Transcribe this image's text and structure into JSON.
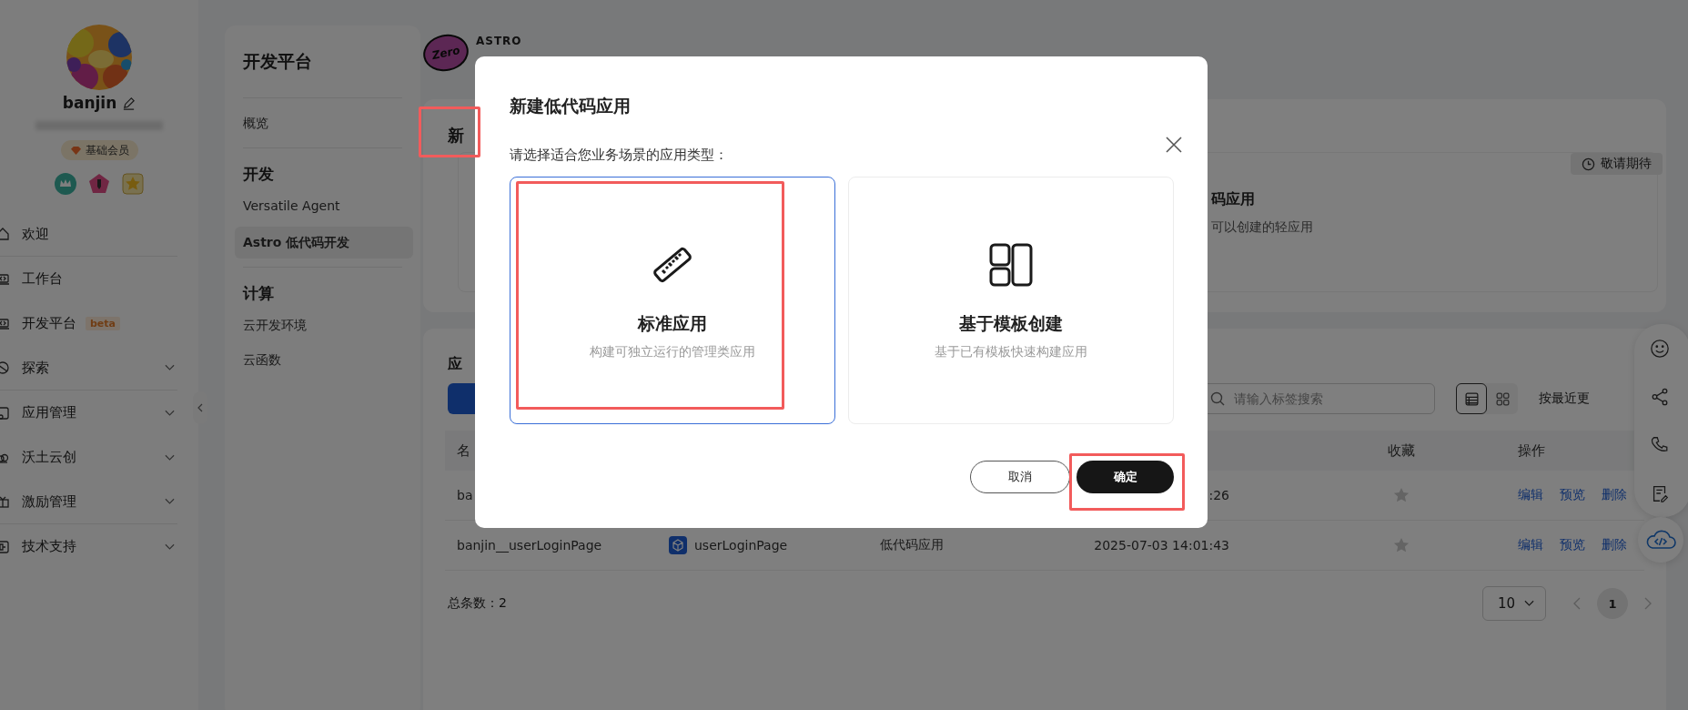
{
  "sidebar": {
    "user": {
      "name": "banjin",
      "badge": "基础会员"
    },
    "nav": [
      {
        "label": "欢迎",
        "expandable": false,
        "divider": true
      },
      {
        "label": "工作台",
        "expandable": false,
        "divider": false
      },
      {
        "label": "开发平台",
        "expandable": false,
        "divider": false,
        "tag": "beta"
      },
      {
        "label": "探索",
        "expandable": true,
        "divider": true
      },
      {
        "label": "应用管理",
        "expandable": true,
        "divider": false
      },
      {
        "label": "沃土云创",
        "expandable": true,
        "divider": false
      },
      {
        "label": "激励管理",
        "expandable": true,
        "divider": true
      },
      {
        "label": "技术支持",
        "expandable": true,
        "divider": false
      }
    ]
  },
  "dev_nav": {
    "title": "开发平台",
    "sections": [
      {
        "items": [
          {
            "label": "概览",
            "selected": false
          }
        ]
      },
      {
        "heading": "开发",
        "items": [
          {
            "label": "Versatile Agent",
            "selected": false
          },
          {
            "label": "Astro 低代码开发",
            "selected": true
          }
        ]
      },
      {
        "heading": "计算",
        "items": [
          {
            "label": "云开发环境",
            "selected": false
          },
          {
            "label": "云函数",
            "selected": false
          }
        ]
      }
    ]
  },
  "logo": {
    "mark": "Zero",
    "name": "ASTRO"
  },
  "create_card": {
    "title": "新",
    "highlighted": true,
    "badge": "敬请期待",
    "option_title": "码应用",
    "option_desc": "可以创建的轻应用"
  },
  "apps_card": {
    "title": "应",
    "search_placeholder": "请输入标签搜索",
    "views": [
      {
        "kind": "list",
        "selected": true
      },
      {
        "kind": "grid",
        "selected": false
      }
    ],
    "sort": "按最近更",
    "columns": [
      "名",
      "收藏",
      "操作"
    ],
    "rows": [
      {
        "name": "ba",
        "time": ":26",
        "favorite": false,
        "actions": [
          "编辑",
          "预览",
          "删除"
        ]
      },
      {
        "name": "banjin__userLoginPage",
        "app": "userLoginPage",
        "type": "低代码应用",
        "time": "2025-07-03 14:01:43",
        "favorite": false,
        "actions": [
          "编辑",
          "预览",
          "删除"
        ]
      }
    ],
    "total": "总条数：2",
    "page_size": "10",
    "pages": [
      {
        "label": "1",
        "selected": true
      }
    ]
  },
  "modal": {
    "title": "新建低代码应用",
    "prompt": "请选择适合您业务场景的应用类型：",
    "options": [
      {
        "kind": "ruler",
        "title": "标准应用",
        "desc": "构建可独立运行的管理类应用",
        "selected": true,
        "highlighted": true
      },
      {
        "kind": "layout",
        "title": "基于模板创建",
        "desc": "基于已有模板快速构建应用",
        "selected": false,
        "highlighted": false
      }
    ],
    "cancel": "取消",
    "confirm": {
      "label": "确定",
      "highlighted": true
    }
  }
}
